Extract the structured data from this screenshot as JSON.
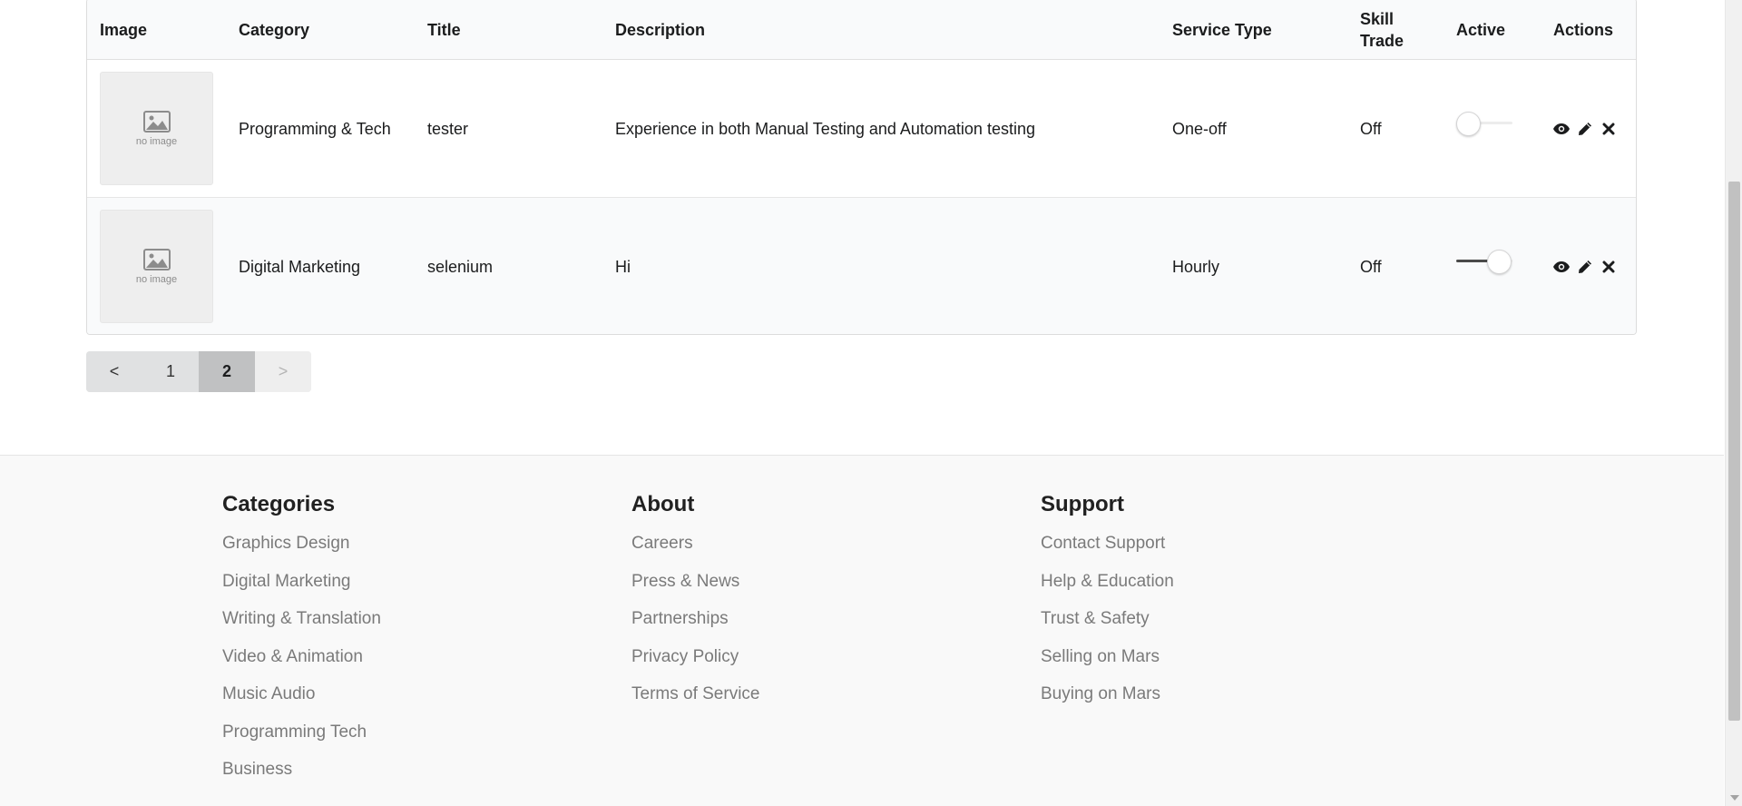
{
  "table": {
    "headers": {
      "image": "Image",
      "category": "Category",
      "title": "Title",
      "description": "Description",
      "service_type": "Service Type",
      "skill_trade": "Skill Trade",
      "active": "Active",
      "actions": "Actions"
    },
    "rows": [
      {
        "image_placeholder": "no image",
        "category": "Programming & Tech",
        "title": "tester",
        "description": "Experience in both Manual Testing and Automation testing",
        "service_type": "One-off",
        "skill_trade": "Off",
        "active": false,
        "actions": [
          "eye-icon",
          "pencil-icon",
          "close-icon"
        ]
      },
      {
        "image_placeholder": "no image",
        "category": "Digital Marketing",
        "title": "selenium",
        "description": "Hi",
        "service_type": "Hourly",
        "skill_trade": "Off",
        "active": true,
        "actions": [
          "eye-icon",
          "pencil-icon",
          "close-icon"
        ]
      }
    ]
  },
  "pagination": {
    "prev": "<",
    "pages": [
      "1",
      "2"
    ],
    "current": "2",
    "next": ">"
  },
  "footer": {
    "categories": {
      "heading": "Categories",
      "links": [
        "Graphics Design",
        "Digital Marketing",
        "Writing & Translation",
        "Video & Animation",
        "Music Audio",
        "Programming Tech",
        "Business"
      ]
    },
    "about": {
      "heading": "About",
      "links": [
        "Careers",
        "Press & News",
        "Partnerships",
        "Privacy Policy",
        "Terms of Service"
      ]
    },
    "support": {
      "heading": "Support",
      "links": [
        "Contact Support",
        "Help & Education",
        "Trust & Safety",
        "Selling on Mars",
        "Buying on Mars"
      ]
    }
  },
  "colors": {
    "header_bg": "#f9fafb",
    "footer_bg": "#f9f9f9",
    "link_gray": "#7a7a7a",
    "active_page": "#c0c1c2"
  }
}
